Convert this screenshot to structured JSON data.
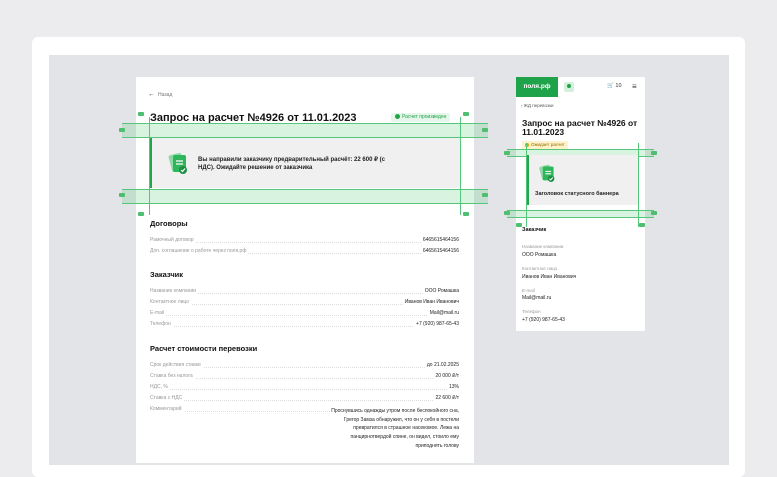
{
  "desktop": {
    "back_label": "Назад",
    "title": "Запрос на расчет №4926 от 11.01.2023",
    "status_badge": "Расчет произведен",
    "banner_text": "Вы направили заказчику предварительный расчёт: 22 600 ₽ (с НДС). Ожидайте решение от заказчика",
    "sections": [
      {
        "heading": "Договоры",
        "rows": [
          {
            "key": "Рамочный договор",
            "value": "6465615464156"
          },
          {
            "key": "Доп. соглашение о работе через поля.рф",
            "value": "6465615464156"
          }
        ]
      },
      {
        "heading": "Заказчик",
        "rows": [
          {
            "key": "Название компании",
            "value": "ООО Ромашка"
          },
          {
            "key": "Контактное лицо",
            "value": "Иванов Иван Иванович"
          },
          {
            "key": "E-mail",
            "value": "Mail@mail.ru"
          },
          {
            "key": "Телефон",
            "value": "+7 (920) 987-65-43"
          }
        ]
      },
      {
        "heading": "Расчет стоимости перевозки",
        "rows": [
          {
            "key": "Срок действия ставки",
            "value": "до 21.02.2025"
          },
          {
            "key": "Ставка без налога",
            "value": "20 000 ₽/т"
          },
          {
            "key": "НДС, %",
            "value": "13%"
          },
          {
            "key": "Ставка с НДС",
            "value": "22 600 ₽/т"
          },
          {
            "key": "Комментарий",
            "value": ""
          }
        ]
      }
    ],
    "comment_text": "Проснувшись однажды утром после беспокойного сна, Грегор Замза обнаружил, что он у себя в постели превратился в страшное насекомое. Лежа на панцирнотвердой спине, он видел, стоило ему приподнять голову"
  },
  "mobile": {
    "logo": "поля.рф",
    "cart_count": "10",
    "back_label": "ЖД перевозки",
    "title": "Запрос на расчет №4926 от 11.01.2023",
    "status_badge": "Ожидает расчет",
    "banner_title": "Заголовок статусного баннера",
    "section_heading": "Заказчик",
    "fields": [
      {
        "key": "Название компании",
        "value": "ООО Ромашка"
      },
      {
        "key": "Контактное лицо",
        "value": "Иванов Иван Иванович"
      },
      {
        "key": "E-mail",
        "value": "Mail@mail.ru"
      },
      {
        "key": "Телефон",
        "value": "+7 (920) 987-65-43"
      }
    ]
  },
  "colors": {
    "accent": "#1fa34a",
    "guide": "#55c77a",
    "pending": "#e0a400"
  },
  "icons": [
    "arrow-left-icon",
    "check-circle-icon",
    "document-check-icon",
    "user-icon",
    "cart-icon",
    "menu-icon",
    "clock-icon"
  ]
}
